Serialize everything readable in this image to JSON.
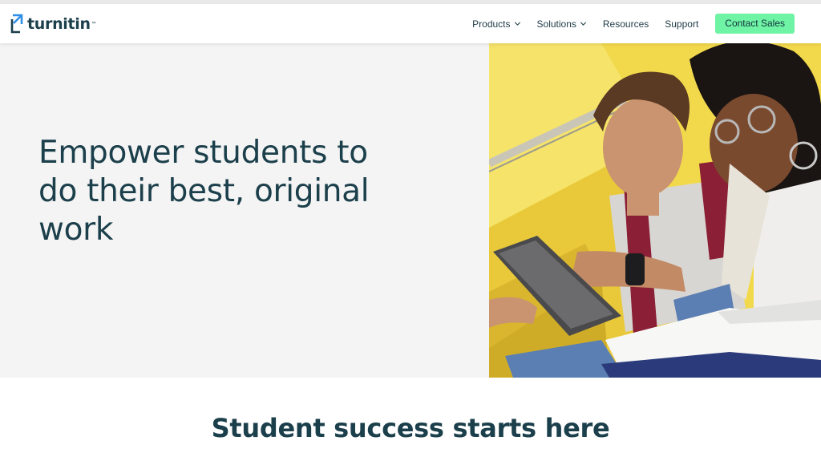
{
  "header": {
    "logo_text": "turnitin",
    "logo_tm": "™",
    "nav": [
      {
        "label": "Products",
        "has_dropdown": true
      },
      {
        "label": "Solutions",
        "has_dropdown": true
      },
      {
        "label": "Resources",
        "has_dropdown": false
      },
      {
        "label": "Support",
        "has_dropdown": false
      }
    ],
    "cta_label": "Contact Sales"
  },
  "hero": {
    "headline": "Empower students to do their best, original work",
    "image_subject": "two students on stairs looking at a tablet"
  },
  "section": {
    "title": "Student success starts here"
  },
  "colors": {
    "brand_dark": "#1b3f4b",
    "cta_green": "#6ff3a4",
    "logo_blue": "#2f8fe6",
    "hero_bg": "#f4f4f4",
    "photo_yellow": "#f2d94c"
  },
  "icons": [
    "turnitin-logo-icon",
    "chevron-down-icon"
  ]
}
